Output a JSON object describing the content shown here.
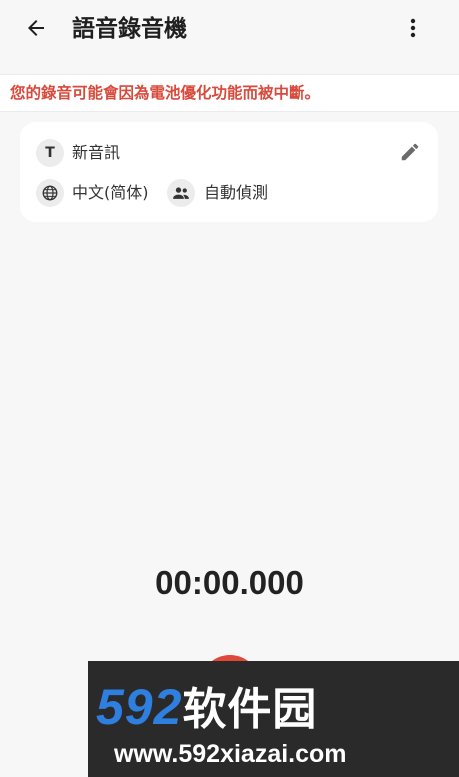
{
  "appbar": {
    "title": "語音錄音機",
    "back_icon": "arrow-left-icon",
    "menu_icon": "more-vertical-icon"
  },
  "warning": {
    "text": "您的錄音可能會因為電池優化功能而被中斷。",
    "color": "#d84a3c"
  },
  "card": {
    "name_icon_glyph": "T",
    "name": "新音訊",
    "language": "中文(简体)",
    "speaker": "自動偵測",
    "edit_icon": "pencil-icon",
    "language_icon": "globe-icon",
    "speaker_icon": "people-icon"
  },
  "recorder": {
    "timer": "00:00.000",
    "record_color": "#e0493a"
  },
  "watermark": {
    "logo_number": "592",
    "logo_text": "软件园",
    "url": "www.592xiazai.com"
  }
}
